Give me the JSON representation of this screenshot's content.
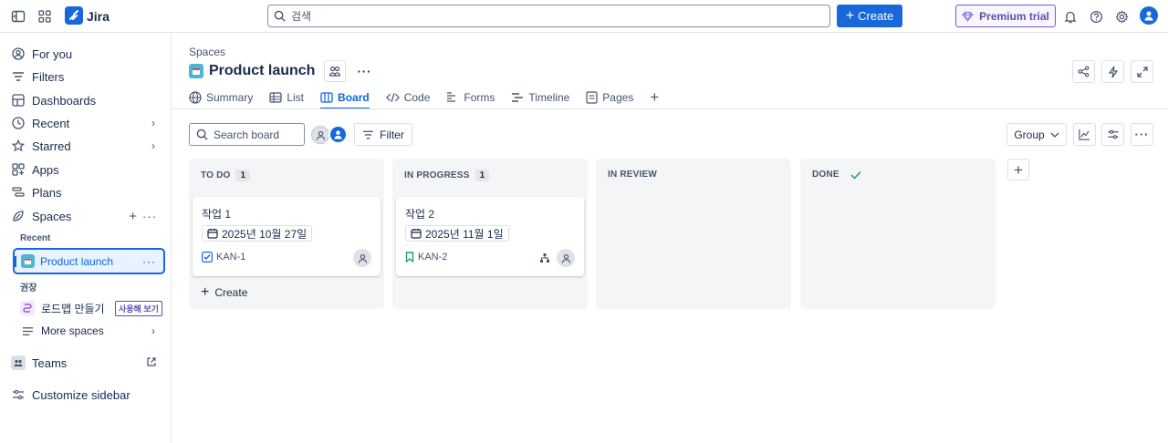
{
  "topbar": {
    "brand": "Jira",
    "search_placeholder": "검색",
    "create_label": "Create",
    "premium_label": "Premium trial"
  },
  "sidebar": {
    "for_you": "For you",
    "filters": "Filters",
    "dashboards": "Dashboards",
    "recent": "Recent",
    "starred": "Starred",
    "apps": "Apps",
    "plans": "Plans",
    "spaces": "Spaces",
    "recent_heading": "Recent",
    "active_project": "Product launch",
    "recommended_heading": "권장",
    "roadmap_label": "로드맵 만들기",
    "try_badge": "사용해 보기",
    "more_spaces": "More spaces",
    "teams": "Teams",
    "customize": "Customize sidebar"
  },
  "main": {
    "breadcrumb": "Spaces",
    "title": "Product launch",
    "tabs": [
      "Summary",
      "List",
      "Board",
      "Code",
      "Forms",
      "Timeline",
      "Pages"
    ],
    "search_board_placeholder": "Search board",
    "filter_label": "Filter",
    "group_label": "Group"
  },
  "board": {
    "columns": [
      {
        "name": "TO DO",
        "count": "1",
        "create_label": "Create",
        "card": {
          "title": "작업 1",
          "date": "2025년 10월 27일",
          "key": "KAN-1",
          "type": "task"
        }
      },
      {
        "name": "IN PROGRESS",
        "count": "1",
        "card": {
          "title": "작업 2",
          "date": "2025년 11월 1일",
          "key": "KAN-2",
          "type": "story"
        }
      },
      {
        "name": "IN REVIEW"
      },
      {
        "name": "DONE"
      }
    ]
  },
  "colors": {
    "accent": "#1868db",
    "premium": "#5e4db2",
    "column_bg": "#f4f5f7"
  }
}
